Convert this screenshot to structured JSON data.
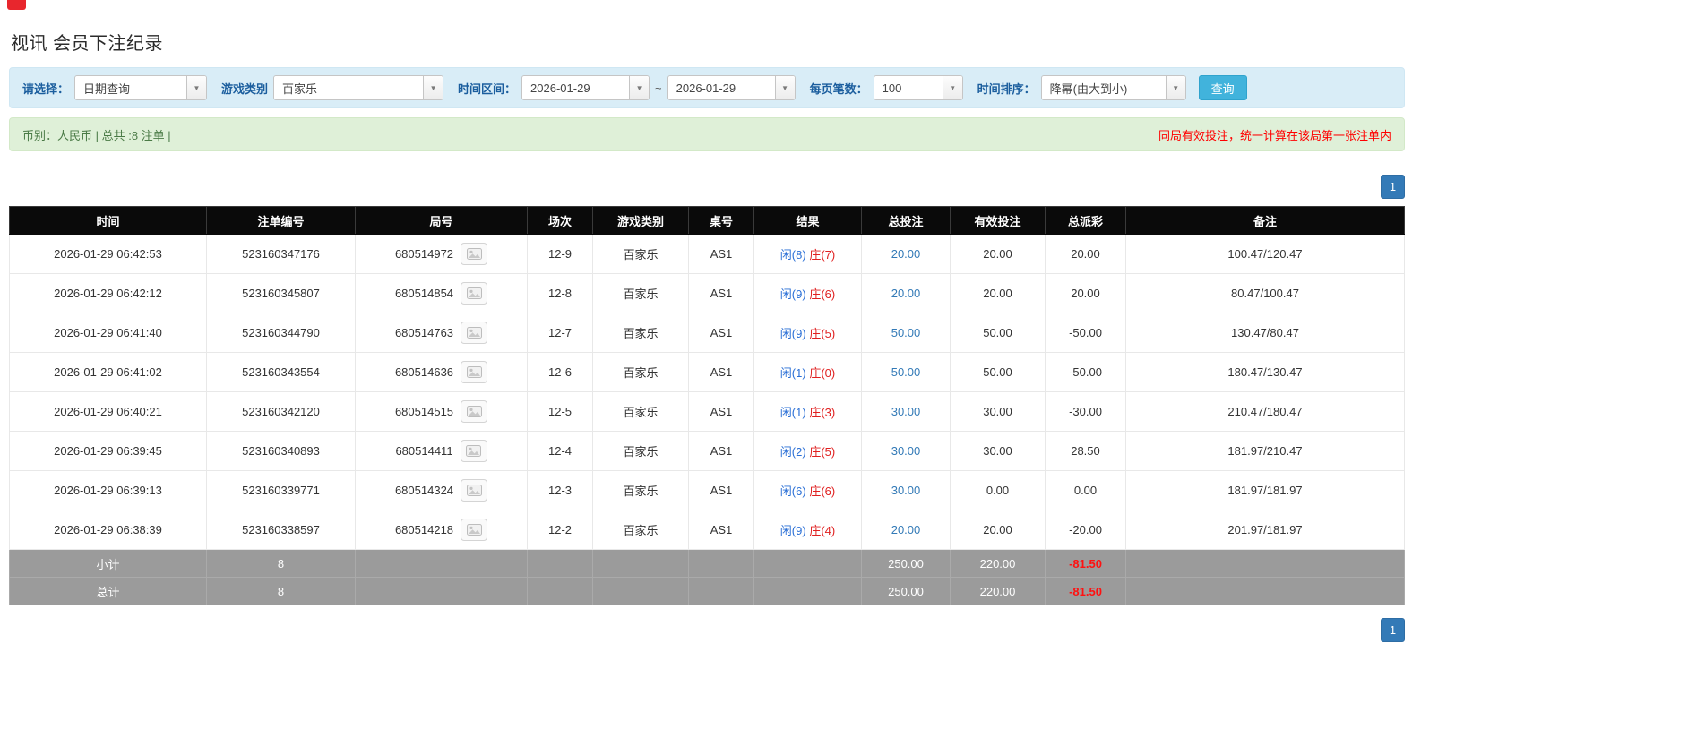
{
  "page": {
    "title": "视讯 会员下注纪录"
  },
  "icons": {
    "dropdown_arrow": "▼",
    "round_result": "card-image-icon"
  },
  "filters": {
    "select_label": "请选择：",
    "select_value": "日期查询",
    "game_type_label": "游戏类别",
    "game_type_value": "百家乐",
    "time_range_label": "时间区间：",
    "date_from": "2026-01-29",
    "tilde": "~",
    "date_to": "2026-01-29",
    "page_size_label": "每页笔数：",
    "page_size_value": "100",
    "sort_label": "时间排序：",
    "sort_value": "降幂(由大到小)",
    "search_button": "查询"
  },
  "summary": {
    "left": "币别：人民币 | 总共 :8 注单 |",
    "right": "同局有效投注，统一计算在该局第一张注单内"
  },
  "pagination": {
    "page": "1"
  },
  "table": {
    "headers": [
      "时间",
      "注单编号",
      "局号",
      "场次",
      "游戏类别",
      "桌号",
      "结果",
      "总投注",
      "有效投注",
      "总派彩",
      "备注"
    ],
    "rows": [
      {
        "time": "2026-01-29 06:42:53",
        "bet_id": "523160347176",
        "round_id": "680514972",
        "session": "12-9",
        "game": "百家乐",
        "table": "AS1",
        "result_player": "闲(8)",
        "result_banker": "庄(7)",
        "total_bet": "20.00",
        "valid_bet": "20.00",
        "payout": "20.00",
        "note": "100.47/120.47"
      },
      {
        "time": "2026-01-29 06:42:12",
        "bet_id": "523160345807",
        "round_id": "680514854",
        "session": "12-8",
        "game": "百家乐",
        "table": "AS1",
        "result_player": "闲(9)",
        "result_banker": "庄(6)",
        "total_bet": "20.00",
        "valid_bet": "20.00",
        "payout": "20.00",
        "note": "80.47/100.47"
      },
      {
        "time": "2026-01-29 06:41:40",
        "bet_id": "523160344790",
        "round_id": "680514763",
        "session": "12-7",
        "game": "百家乐",
        "table": "AS1",
        "result_player": "闲(9)",
        "result_banker": "庄(5)",
        "total_bet": "50.00",
        "valid_bet": "50.00",
        "payout": "-50.00",
        "note": "130.47/80.47"
      },
      {
        "time": "2026-01-29 06:41:02",
        "bet_id": "523160343554",
        "round_id": "680514636",
        "session": "12-6",
        "game": "百家乐",
        "table": "AS1",
        "result_player": "闲(1)",
        "result_banker": "庄(0)",
        "total_bet": "50.00",
        "valid_bet": "50.00",
        "payout": "-50.00",
        "note": "180.47/130.47"
      },
      {
        "time": "2026-01-29 06:40:21",
        "bet_id": "523160342120",
        "round_id": "680514515",
        "session": "12-5",
        "game": "百家乐",
        "table": "AS1",
        "result_player": "闲(1)",
        "result_banker": "庄(3)",
        "total_bet": "30.00",
        "valid_bet": "30.00",
        "payout": "-30.00",
        "note": "210.47/180.47"
      },
      {
        "time": "2026-01-29 06:39:45",
        "bet_id": "523160340893",
        "round_id": "680514411",
        "session": "12-4",
        "game": "百家乐",
        "table": "AS1",
        "result_player": "闲(2)",
        "result_banker": "庄(5)",
        "total_bet": "30.00",
        "valid_bet": "30.00",
        "payout": "28.50",
        "note": "181.97/210.47"
      },
      {
        "time": "2026-01-29 06:39:13",
        "bet_id": "523160339771",
        "round_id": "680514324",
        "session": "12-3",
        "game": "百家乐",
        "table": "AS1",
        "result_player": "闲(6)",
        "result_banker": "庄(6)",
        "total_bet": "30.00",
        "valid_bet": "0.00",
        "payout": "0.00",
        "note": "181.97/181.97"
      },
      {
        "time": "2026-01-29 06:38:39",
        "bet_id": "523160338597",
        "round_id": "680514218",
        "session": "12-2",
        "game": "百家乐",
        "table": "AS1",
        "result_player": "闲(9)",
        "result_banker": "庄(4)",
        "total_bet": "20.00",
        "valid_bet": "20.00",
        "payout": "-20.00",
        "note": "201.97/181.97"
      }
    ],
    "subtotal": {
      "label": "小计",
      "count": "8",
      "total_bet": "250.00",
      "valid_bet": "220.00",
      "payout": "-81.50"
    },
    "total": {
      "label": "总计",
      "count": "8",
      "total_bet": "250.00",
      "valid_bet": "220.00",
      "payout": "-81.50"
    }
  }
}
